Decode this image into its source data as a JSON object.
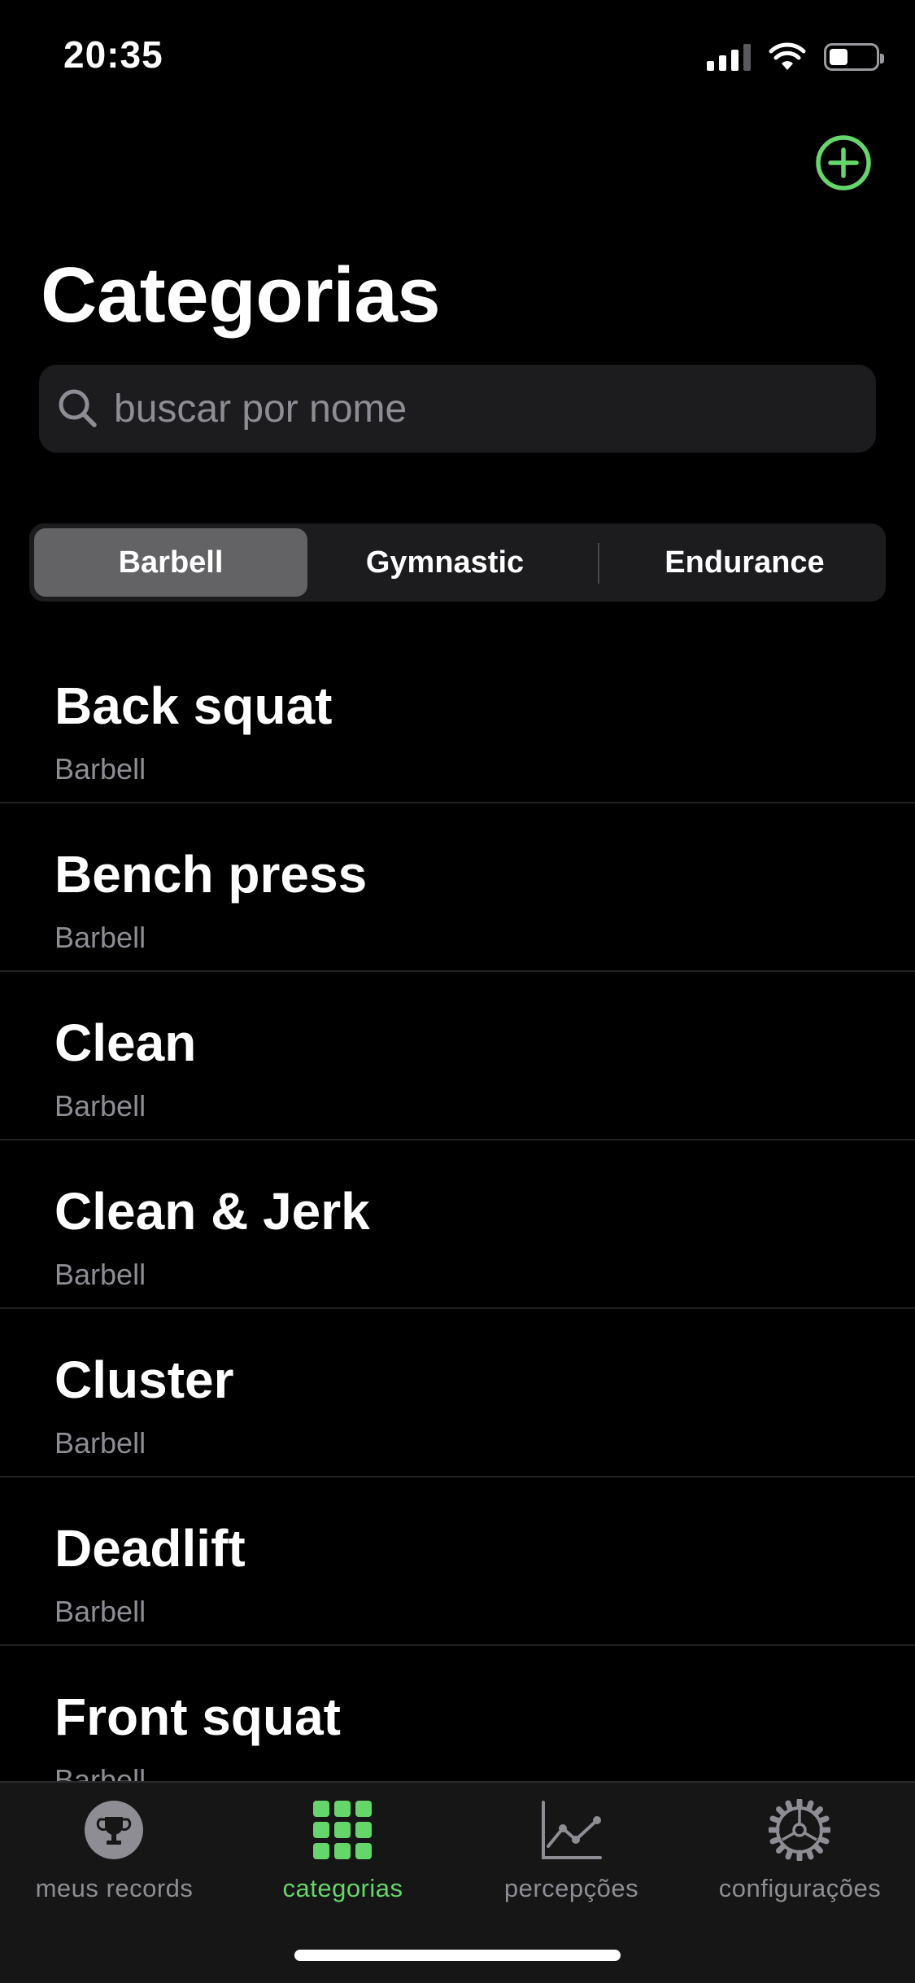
{
  "status_bar": {
    "time": "20:35",
    "icons": [
      "signal-icon",
      "wifi-icon",
      "battery-icon"
    ]
  },
  "header": {
    "add_icon": "plus-circle-icon",
    "title": "Categorias"
  },
  "search": {
    "icon": "search-icon",
    "placeholder": "buscar por nome",
    "value": ""
  },
  "segments": {
    "selected": "Barbell",
    "items": [
      {
        "label": "Barbell"
      },
      {
        "label": "Gymnastic"
      },
      {
        "label": "Endurance"
      }
    ]
  },
  "list": {
    "items": [
      {
        "title": "Back squat",
        "subtitle": "Barbell"
      },
      {
        "title": "Bench press",
        "subtitle": "Barbell"
      },
      {
        "title": "Clean",
        "subtitle": "Barbell"
      },
      {
        "title": "Clean & Jerk",
        "subtitle": "Barbell"
      },
      {
        "title": "Cluster",
        "subtitle": "Barbell"
      },
      {
        "title": "Deadlift",
        "subtitle": "Barbell"
      },
      {
        "title": "Front squat",
        "subtitle": "Barbell"
      }
    ]
  },
  "tab_bar": {
    "active": "categorias",
    "tabs": [
      {
        "label": "meus records",
        "icon": "trophy-icon"
      },
      {
        "label": "categorias",
        "icon": "grid-icon"
      },
      {
        "label": "percepções",
        "icon": "line-chart-icon"
      },
      {
        "label": "configurações",
        "icon": "gear-icon"
      }
    ]
  },
  "colors": {
    "accent": "#64d66a",
    "background": "#000000",
    "surface": "#1c1c1e",
    "segment_selected": "#636366",
    "secondary_text": "#8d8d93"
  }
}
